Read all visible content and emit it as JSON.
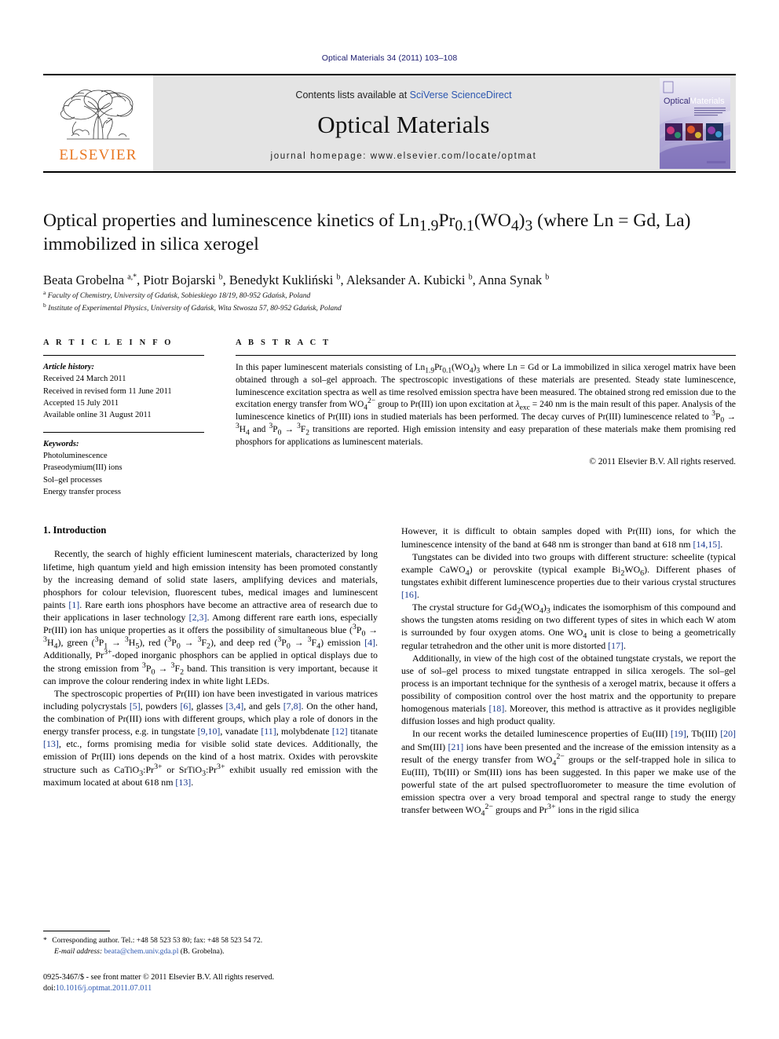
{
  "running_head": "Optical Materials 34 (2011) 103–108",
  "masthead": {
    "publisher_logo_text": "ELSEVIER",
    "contents_prefix": "Contents lists available at ",
    "contents_link": "SciVerse ScienceDirect",
    "journal_name": "Optical Materials",
    "homepage": "journal homepage: www.elsevier.com/locate/optmat",
    "cover_title_1": "Optical",
    "cover_title_2": "Materials"
  },
  "article": {
    "title": "Optical properties and luminescence kinetics of Ln1.9Pr0.1(WO4)3 (where Ln = Gd, La) immobilized in silica xerogel",
    "title_html": "Optical properties and luminescence kinetics of Ln<sub>1.9</sub>Pr<sub>0.1</sub>(WO<sub>4</sub>)<sub>3</sub> (where Ln = Gd, La) immobilized in silica xerogel",
    "authors_html": "Beata Grobelna <sup>a,</sup><sup>*</sup>, Piotr Bojarski <sup>b</sup>, Benedykt Kukliński <sup>b</sup>, Aleksander A. Kubicki <sup>b</sup>, Anna Synak <sup>b</sup>",
    "affiliation_a": "Faculty of Chemistry, University of Gdańsk, Sobieskiego 18/19, 80-952 Gdańsk, Poland",
    "affiliation_b": "Institute of Experimental Physics, University of Gdańsk, Wita Stwosza 57, 80-952 Gdańsk, Poland"
  },
  "article_info": {
    "heading": "A R T I C L E    I N F O",
    "history_label": "Article history:",
    "history": [
      "Received 24 March 2011",
      "Received in revised form 11 June 2011",
      "Accepted 15 July 2011",
      "Available online 31 August 2011"
    ],
    "keywords_label": "Keywords:",
    "keywords": [
      "Photoluminescence",
      "Praseodymium(III) ions",
      "Sol–gel processes",
      "Energy transfer process"
    ]
  },
  "abstract": {
    "heading": "A B S T R A C T",
    "text_html": "In this paper luminescent materials consisting of Ln<sub>1.9</sub>Pr<sub>0.1</sub>(WO<sub>4</sub>)<sub>3</sub> where Ln = Gd or La immobilized in silica xerogel matrix have been obtained through a sol–gel approach. The spectroscopic investigations of these materials are presented. Steady state luminescence, luminescence excitation spectra as well as time resolved emission spectra have been measured. The obtained strong red emission due to the excitation energy transfer from WO<sub>4</sub><sup>2−</sup> group to Pr(III) ion upon excitation at <i>λ</i><sub>exc</sub> = 240 nm is the main result of this paper. Analysis of the luminescence kinetics of Pr(III) ions in studied materials has been performed. The decay curves of Pr(III) luminescence related to <sup>3</sup>P<sub>0</sub> → <sup>3</sup>H<sub>4</sub> and <sup>3</sup>P<sub>0</sub> → <sup>3</sup>F<sub>2</sub> transitions are reported. High emission intensity and easy preparation of these materials make them promising red phosphors for applications as luminescent materials.",
    "copyright": "© 2011 Elsevier B.V. All rights reserved."
  },
  "body": {
    "section_1_heading": "1. Introduction",
    "left_paragraphs_html": [
      "Recently, the search of highly efficient luminescent materials, characterized by long lifetime, high quantum yield and high emission intensity has been promoted constantly by the increasing demand of solid state lasers, amplifying devices and materials, phosphors for colour television, fluorescent tubes, medical images and luminescent paints <span class=\"ref\">[1]</span>. Rare earth ions phosphors have become an attractive area of research due to their applications in laser technology <span class=\"ref\">[2,3]</span>. Among different rare earth ions, especially Pr(III) ion has unique properties as it offers the possibility of simultaneous blue (<sup>3</sup>P<sub>0</sub> → <sup>3</sup>H<sub>4</sub>), green (<sup>3</sup>P<sub>1</sub> → <sup>3</sup>H<sub>5</sub>), red (<sup>3</sup>P<sub>0</sub> → <sup>3</sup>F<sub>2</sub>), and deep red (<sup>3</sup>P<sub>0</sub> → <sup>3</sup>F<sub>4</sub>) emission <span class=\"ref\">[4]</span>. Additionally, Pr<sup>3+</sup>-doped inorganic phosphors can be applied in optical displays due to the strong emission from <sup>3</sup>P<sub>0</sub> → <sup>3</sup>F<sub>2</sub> band. This transition is very important, because it can improve the colour rendering index in white light LEDs.",
      "The spectroscopic properties of Pr(III) ion have been investigated in various matrices including polycrystals <span class=\"ref\">[5]</span>, powders <span class=\"ref\">[6]</span>, glasses <span class=\"ref\">[3,4]</span>, and gels <span class=\"ref\">[7,8]</span>. On the other hand, the combination of Pr(III) ions with different groups, which play a role of donors in the energy transfer process, e.g. in tungstate <span class=\"ref\">[9,10]</span>, vanadate <span class=\"ref\">[11]</span>, molybdenate <span class=\"ref\">[12]</span> titanate <span class=\"ref\">[13]</span>, etc., forms promising media for visible solid state devices. Additionally, the emission of Pr(III) ions depends on the kind of a host matrix. Oxides with perovskite structure such as CaTiO<sub>3</sub>:Pr<sup>3+</sup> or SrTiO<sub>3</sub>:Pr<sup>3+</sup> exhibit usually red emission with the maximum located at about 618 nm <span class=\"ref\">[13]</span>."
    ],
    "right_paragraphs_html": [
      "However, it is difficult to obtain samples doped with Pr(III) ions, for which the luminescence intensity of the band at 648 nm is stronger than band at 618 nm <span class=\"ref\">[14,15]</span>.",
      "Tungstates can be divided into two groups with different structure: scheelite (typical example CaWO<sub>4</sub>) or perovskite (typical example Bi<sub>2</sub>WO<sub>6</sub>). Different phases of tungstates exhibit different luminescence properties due to their various crystal structures <span class=\"ref\">[16]</span>.",
      "The crystal structure for Gd<sub>2</sub>(WO<sub>4</sub>)<sub>3</sub> indicates the isomorphism of this compound and shows the tungsten atoms residing on two different types of sites in which each W atom is surrounded by four oxygen atoms. One WO<sub>4</sub> unit is close to being a geometrically regular tetrahedron and the other unit is more distorted <span class=\"ref\">[17]</span>.",
      "Additionally, in view of the high cost of the obtained tungstate crystals, we report the use of sol–gel process to mixed tungstate entrapped in silica xerogels. The sol–gel process is an important technique for the synthesis of a xerogel matrix, because it offers a possibility of composition control over the host matrix and the opportunity to prepare homogenous materials <span class=\"ref\">[18]</span>. Moreover, this method is attractive as it provides negligible diffusion losses and high product quality.",
      "In our recent works the detailed luminescence properties of Eu(III) <span class=\"ref\">[19]</span>, Tb(III) <span class=\"ref\">[20]</span> and Sm(III) <span class=\"ref\">[21]</span> ions have been presented and the increase of the emission intensity as a result of the energy transfer from WO<sub>4</sub><sup>2−</sup> groups or the self-trapped hole in silica to Eu(III), Tb(III) or Sm(III) ions has been suggested. In this paper we make use of the powerful state of the art pulsed spectrofluorometer to measure the time evolution of emission spectra over a very broad temporal and spectral range to study the energy transfer between WO<sub>4</sub><sup>2−</sup> groups and Pr<sup>3+</sup> ions in the rigid silica"
    ]
  },
  "footnote": {
    "corresponding_html": "<span class=\"star\">*</span> Corresponding author. Tel.: +48 58 523 53 80; fax: +48 58 523 54 72.",
    "email_label": "E-mail address:",
    "email": "beata@chem.univ.gda.pl",
    "email_suffix": " (B. Grobelna)."
  },
  "imprint": {
    "line1": "0925-3467/$ - see front matter © 2011 Elsevier B.V. All rights reserved.",
    "doi_label": "doi:",
    "doi": "10.1016/j.optmat.2011.07.011"
  },
  "colors": {
    "link_blue": "#2b56b0",
    "ref_blue": "#1a3a8f",
    "elsevier_orange": "#E87722",
    "masthead_grey": "#e4e4e4",
    "running_head_navy": "#1a1a6e"
  }
}
